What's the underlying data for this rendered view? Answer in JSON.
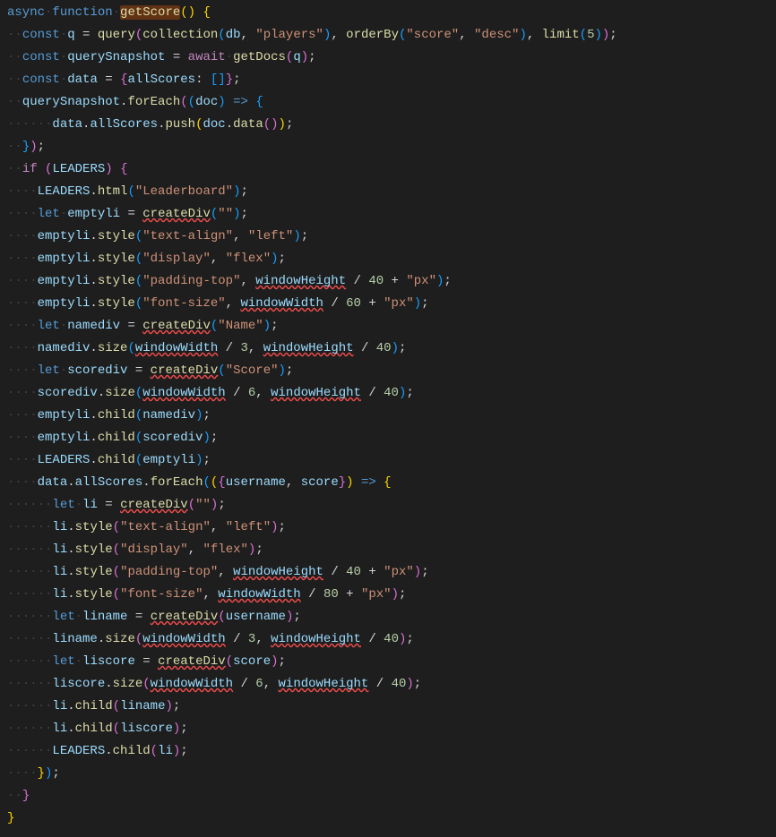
{
  "code": {
    "fn": "getScore",
    "kw": {
      "async": "async",
      "function": "function",
      "const": "const",
      "let": "let",
      "await": "await",
      "if": "if"
    },
    "ids": {
      "q": "q",
      "querySnapshot": "querySnapshot",
      "data": "data",
      "doc": "doc",
      "allScores": "allScores",
      "db": "db",
      "emptyli": "emptyli",
      "namediv": "namediv",
      "scorediv": "scorediv",
      "li": "li",
      "liname": "liname",
      "liscore": "liscore",
      "username": "username",
      "score": "score",
      "LEADERS": "LEADERS",
      "windowHeight": "windowHeight",
      "windowWidth": "windowWidth"
    },
    "calls": {
      "query": "query",
      "collection": "collection",
      "orderBy": "orderBy",
      "limit": "limit",
      "getDocs": "getDocs",
      "forEach": "forEach",
      "push": "push",
      "data": "data",
      "html": "html",
      "createDiv": "createDiv",
      "style": "style",
      "size": "size",
      "child": "child"
    },
    "str": {
      "players": "\"players\"",
      "scoreKey": "\"score\"",
      "desc": "\"desc\"",
      "leaderboard": "\"Leaderboard\"",
      "empty": "\"\"",
      "textAlign": "\"text-align\"",
      "left": "\"left\"",
      "display": "\"display\"",
      "flex": "\"flex\"",
      "paddingTop": "\"padding-top\"",
      "fontSize": "\"font-size\"",
      "name": "\"Name\"",
      "scoreLabel": "\"Score\"",
      "px": "\"px\""
    },
    "num": {
      "five": "5",
      "forty": "40",
      "sixty": "60",
      "eighty": "80",
      "three": "3",
      "six": "6"
    },
    "sym": {
      "arrow": "=>",
      "plus": "+",
      "slash": "/",
      "eq": "=",
      "comma": ",",
      "semi": ";",
      "dot": "."
    }
  }
}
